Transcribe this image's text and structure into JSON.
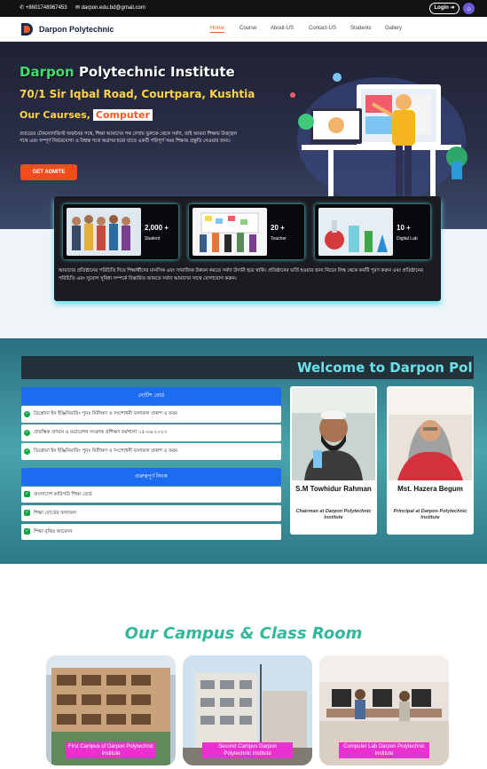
{
  "topbar": {
    "phone": "+8801748967453",
    "email": "darpon.edu.bd@gmail.com",
    "login": "Login"
  },
  "nav": {
    "brand": "Darpon Polytechnic",
    "items": [
      "Home",
      "Course",
      "About-US",
      "Contact-US",
      "Students",
      "Gallery"
    ],
    "active": "Home"
  },
  "hero": {
    "title_hl": "Darpon",
    "title_rest": "Polytechnic Institute",
    "address": "70/1 Sir Iqbal Road, Courtpara, Kushtia",
    "courses_label": "Our Caurses,",
    "course_tag": "Computer",
    "text": "প্রত্যয়ের টেকনোলজিস্ট অর্জনের পথে, শিক্ষা আমাদের পথ দেখায় ভুলকে থেকে সর্বদা, তাই আমরা শিক্ষায় উজ্জ্বল পথে এবং সম্পূর্ণ নির্ভরযোগ্য ও বিশ্বস্ত পথে অগ্রসর হবো যাতে একটি পরিপূর্ণ সময় শিক্ষায় প্রস্তুতি নেওয়ার জন্য।",
    "admit_button": "GET ADMITE"
  },
  "stats": {
    "items": [
      {
        "num": "2,000 +",
        "label": "Student"
      },
      {
        "num": "20 +",
        "label": "Teacher"
      },
      {
        "num": "10 +",
        "label": "Digital Lab"
      }
    ],
    "text": "আমাদের প্রতিষ্ঠানের পরিচিতি দিয়ে শিক্ষার্থীদের মানসিক এবং সামাজিক উন্নয়ন করতে সর্বদা উদ্যমী হয়ে থাকি। প্রতিষ্ঠানের ভর্তি হওয়ার জন্য নিচের লিঙ্ক থেকে ফর্মটি পূরণ করুন এবং প্রতিষ্ঠানের পরিচিতি এবং সুযোগ সুবিধা সম্পর্কে বিস্তারিত জানতে সর্বদা আমাদের সাথে যোগাযোগ করুন।"
  },
  "welcome": "Welcome to Darpon Pol",
  "notice": {
    "title": "নোটিশ বোর্ড",
    "items": [
      "ডিপ্লোমা ইন ইঞ্জিনিয়ারিং পুনঃ নিরীক্ষণ ও সংশোধনী ফলাফল প্রকাশ ও ফরম",
      "প্রারম্ভিক প্রণয়ন ও মডারেশন সংক্রান্ত প্রশিক্ষণ কর্মশালা ১৫-০৬-২০২৩",
      "ডিপ্লোমা ইন ইঞ্জিনিয়ারিং পুনঃ নিরীক্ষণ ও সংশোধনী ফলাফল প্রকাশ ও ফরম"
    ]
  },
  "links": {
    "title": "গুরুত্বপূর্ণ লিংক",
    "items": [
      "বাংলাদেশ কারিগরি শিক্ষা বোর্ড",
      "শিক্ষা বোর্ডের ফলাফল",
      "শিক্ষা বৃত্তির আবেদন"
    ]
  },
  "people": [
    {
      "name": "S.M Towhidur Rahman",
      "role": "Chairman at Darpon Polytechnic Institute"
    },
    {
      "name": "Mst. Hazera Begum",
      "role": "Principal at Darpon Polytechnic Institute"
    }
  ],
  "campus": {
    "title": "Our Campus & Class Room",
    "items": [
      {
        "caption": "First Campus of Darpon Polytechnic Institute"
      },
      {
        "caption": "Second Campus Darpon Polytechnic Institute"
      },
      {
        "caption": "Computer Lab Darpon Polytechnic Institute"
      }
    ]
  },
  "colors": {
    "accent": "#f05a28",
    "notice_blue": "#1c6cf0",
    "teal": "#4aa4ad",
    "campus_title": "#32b89c"
  }
}
